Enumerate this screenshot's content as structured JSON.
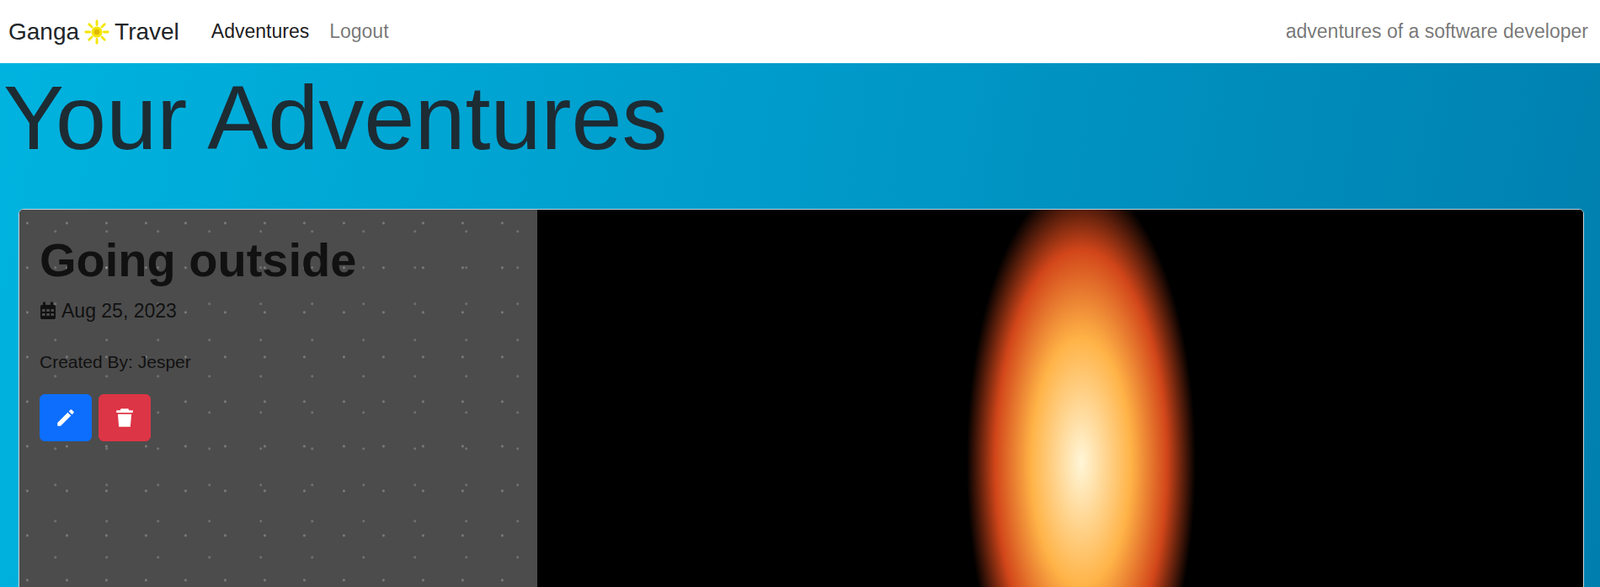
{
  "navbar": {
    "brand": {
      "before": "Ganga",
      "after": "Travel"
    },
    "links": [
      {
        "label": "Adventures",
        "selected": true
      },
      {
        "label": "Logout",
        "selected": false
      }
    ],
    "tagline": "adventures of a software developer"
  },
  "page": {
    "title": "Your Adventures"
  },
  "adventures": [
    {
      "title": "Going outside",
      "date": "Aug 25, 2023",
      "created_by": "Created By: Jesper"
    }
  ]
}
